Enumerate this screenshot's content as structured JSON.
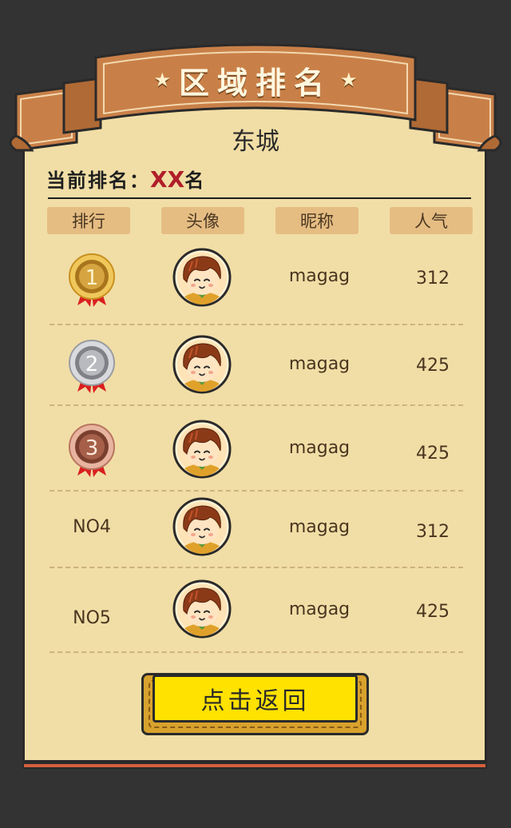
{
  "header": {
    "title": "区域排名"
  },
  "region": {
    "city": "东城"
  },
  "current_rank": {
    "label": "当前排名：",
    "value": "XX",
    "suffix": "名"
  },
  "table": {
    "columns": [
      "排行",
      "头像",
      "昵称",
      "人气"
    ],
    "rows": [
      {
        "rank": "1",
        "medal": "gold-medal-icon",
        "nickname": "magag",
        "popularity": "312"
      },
      {
        "rank": "2",
        "medal": "silver-medal-icon",
        "nickname": "magag",
        "popularity": "425"
      },
      {
        "rank": "3",
        "medal": "bronze-medal-icon",
        "nickname": "magag",
        "popularity": "425"
      },
      {
        "rank": "NO4",
        "medal": "",
        "nickname": "magag",
        "popularity": "312"
      },
      {
        "rank": "NO5",
        "medal": "",
        "nickname": "magag",
        "popularity": "425"
      }
    ]
  },
  "actions": {
    "back_label": "点击返回"
  },
  "colors": {
    "background": "#333333",
    "panel": "#f1dea6",
    "banner": "#c98048",
    "accent_red": "#b01e2a",
    "button": "#ffe200"
  }
}
